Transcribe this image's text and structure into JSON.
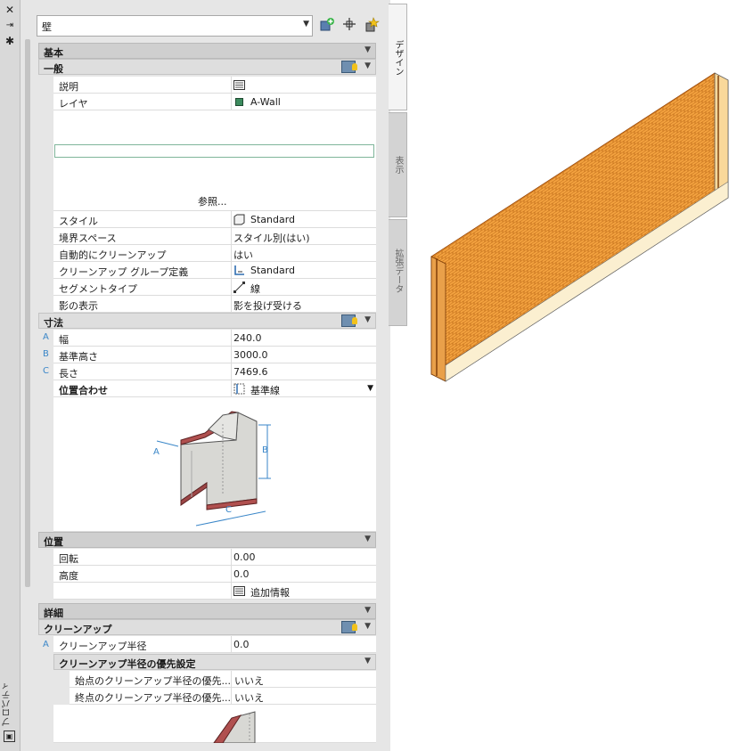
{
  "palette_title": "プロパティ",
  "style_select": {
    "value": "壁"
  },
  "tabs": {
    "design": "デザイン",
    "display": "表示",
    "extended": "拡張データ"
  },
  "sections": {
    "basic": "基本",
    "general": "一般",
    "dimensions": "寸法",
    "location": "位置",
    "detail": "詳細",
    "cleanup": "クリーンアップ",
    "cleanup_override": "クリーンアップ半径の優先設定"
  },
  "general": {
    "description_label": "説明",
    "layer_label": "レイヤ",
    "layer_value": "A-Wall",
    "browse_label": "参照...",
    "style_label": "スタイル",
    "style_value": "Standard",
    "boundary_label": "境界スペース",
    "boundary_value": "スタイル別(はい)",
    "autoclean_label": "自動的にクリーンアップ",
    "autoclean_value": "はい",
    "cleanup_group_label": "クリーンアップ グループ定義",
    "cleanup_group_value": "Standard",
    "segment_label": "セグメントタイプ",
    "segment_value": "線",
    "shadow_label": "影の表示",
    "shadow_value": "影を投げ受ける"
  },
  "dimensions": {
    "width_letter": "A",
    "width_label": "幅",
    "width_value": "240.0",
    "base_height_letter": "B",
    "base_height_label": "基準高さ",
    "base_height_value": "3000.0",
    "length_letter": "C",
    "length_label": "長さ",
    "length_value": "7469.6",
    "justify_label": "位置合わせ",
    "justify_value": "基準線",
    "diagram_labels": {
      "a": "A",
      "b": "B",
      "c": "C"
    }
  },
  "location": {
    "rotation_label": "回転",
    "rotation_value": "0.00",
    "elevation_label": "高度",
    "elevation_value": "0.0",
    "additional_label": "追加情報"
  },
  "cleanup": {
    "radius_letter": "A",
    "radius_label": "クリーンアップ半径",
    "radius_value": "0.0",
    "start_label": "始点のクリーンアップ半径の優先...",
    "start_value": "いいえ",
    "end_label": "終点のクリーンアップ半径の優先...",
    "end_value": "いいえ"
  },
  "colors": {
    "layer_swatch": "#3c8b5e",
    "wall_brick": "#f4a340",
    "letters": "#3a86c8"
  }
}
